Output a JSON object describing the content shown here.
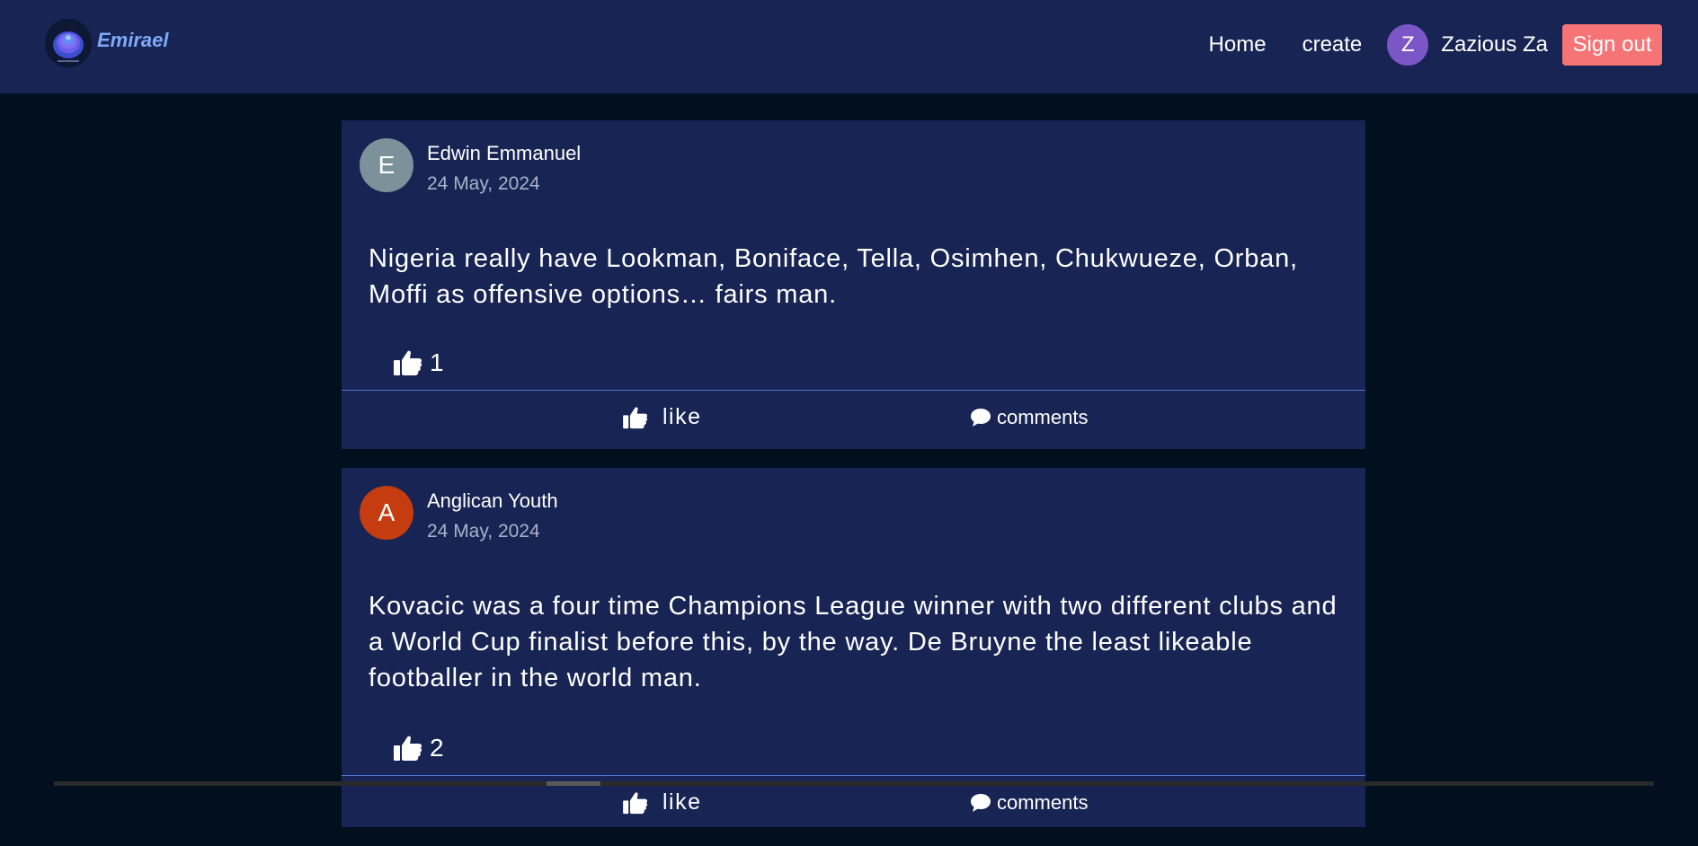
{
  "header": {
    "brand_name": "Emirael",
    "nav": {
      "home": "Home",
      "create": "create"
    },
    "user": {
      "initial": "Z",
      "name": "Zazious Za"
    },
    "sign_out": "Sign out"
  },
  "posts": [
    {
      "author_initial": "E",
      "author_name": "Edwin Emmanuel",
      "date": "24 May, 2024",
      "avatar_color": "#7b929b",
      "body": "Nigeria really have Lookman, Boniface, Tella, Osimhen, Chukwueze, Orban, Moffi as offensive options… fairs man.",
      "likes": "1",
      "like_label": "like",
      "comments_label": "comments"
    },
    {
      "author_initial": "A",
      "author_name": "Anglican Youth",
      "date": "24 May, 2024",
      "avatar_color": "#c43c10",
      "body": "Kovacic was a four time Champions League winner with two different clubs and a World Cup finalist before this, by the way. De Bruyne the least likeable footballer in the world man.",
      "likes": "2",
      "like_label": "like",
      "comments_label": "comments"
    }
  ],
  "colors": {
    "page_bg": "#020f1f",
    "header_bg": "#172454",
    "card_bg": "#172454",
    "brand": "#7fa9f7",
    "sign_out_bg": "#f77476",
    "user_avatar": "#7b56c7",
    "divider": "#4d74c9"
  },
  "icons": {
    "logo": "emirael-logo-icon",
    "like": "thumbs-up-icon",
    "comments": "comment-bubble-icon"
  }
}
